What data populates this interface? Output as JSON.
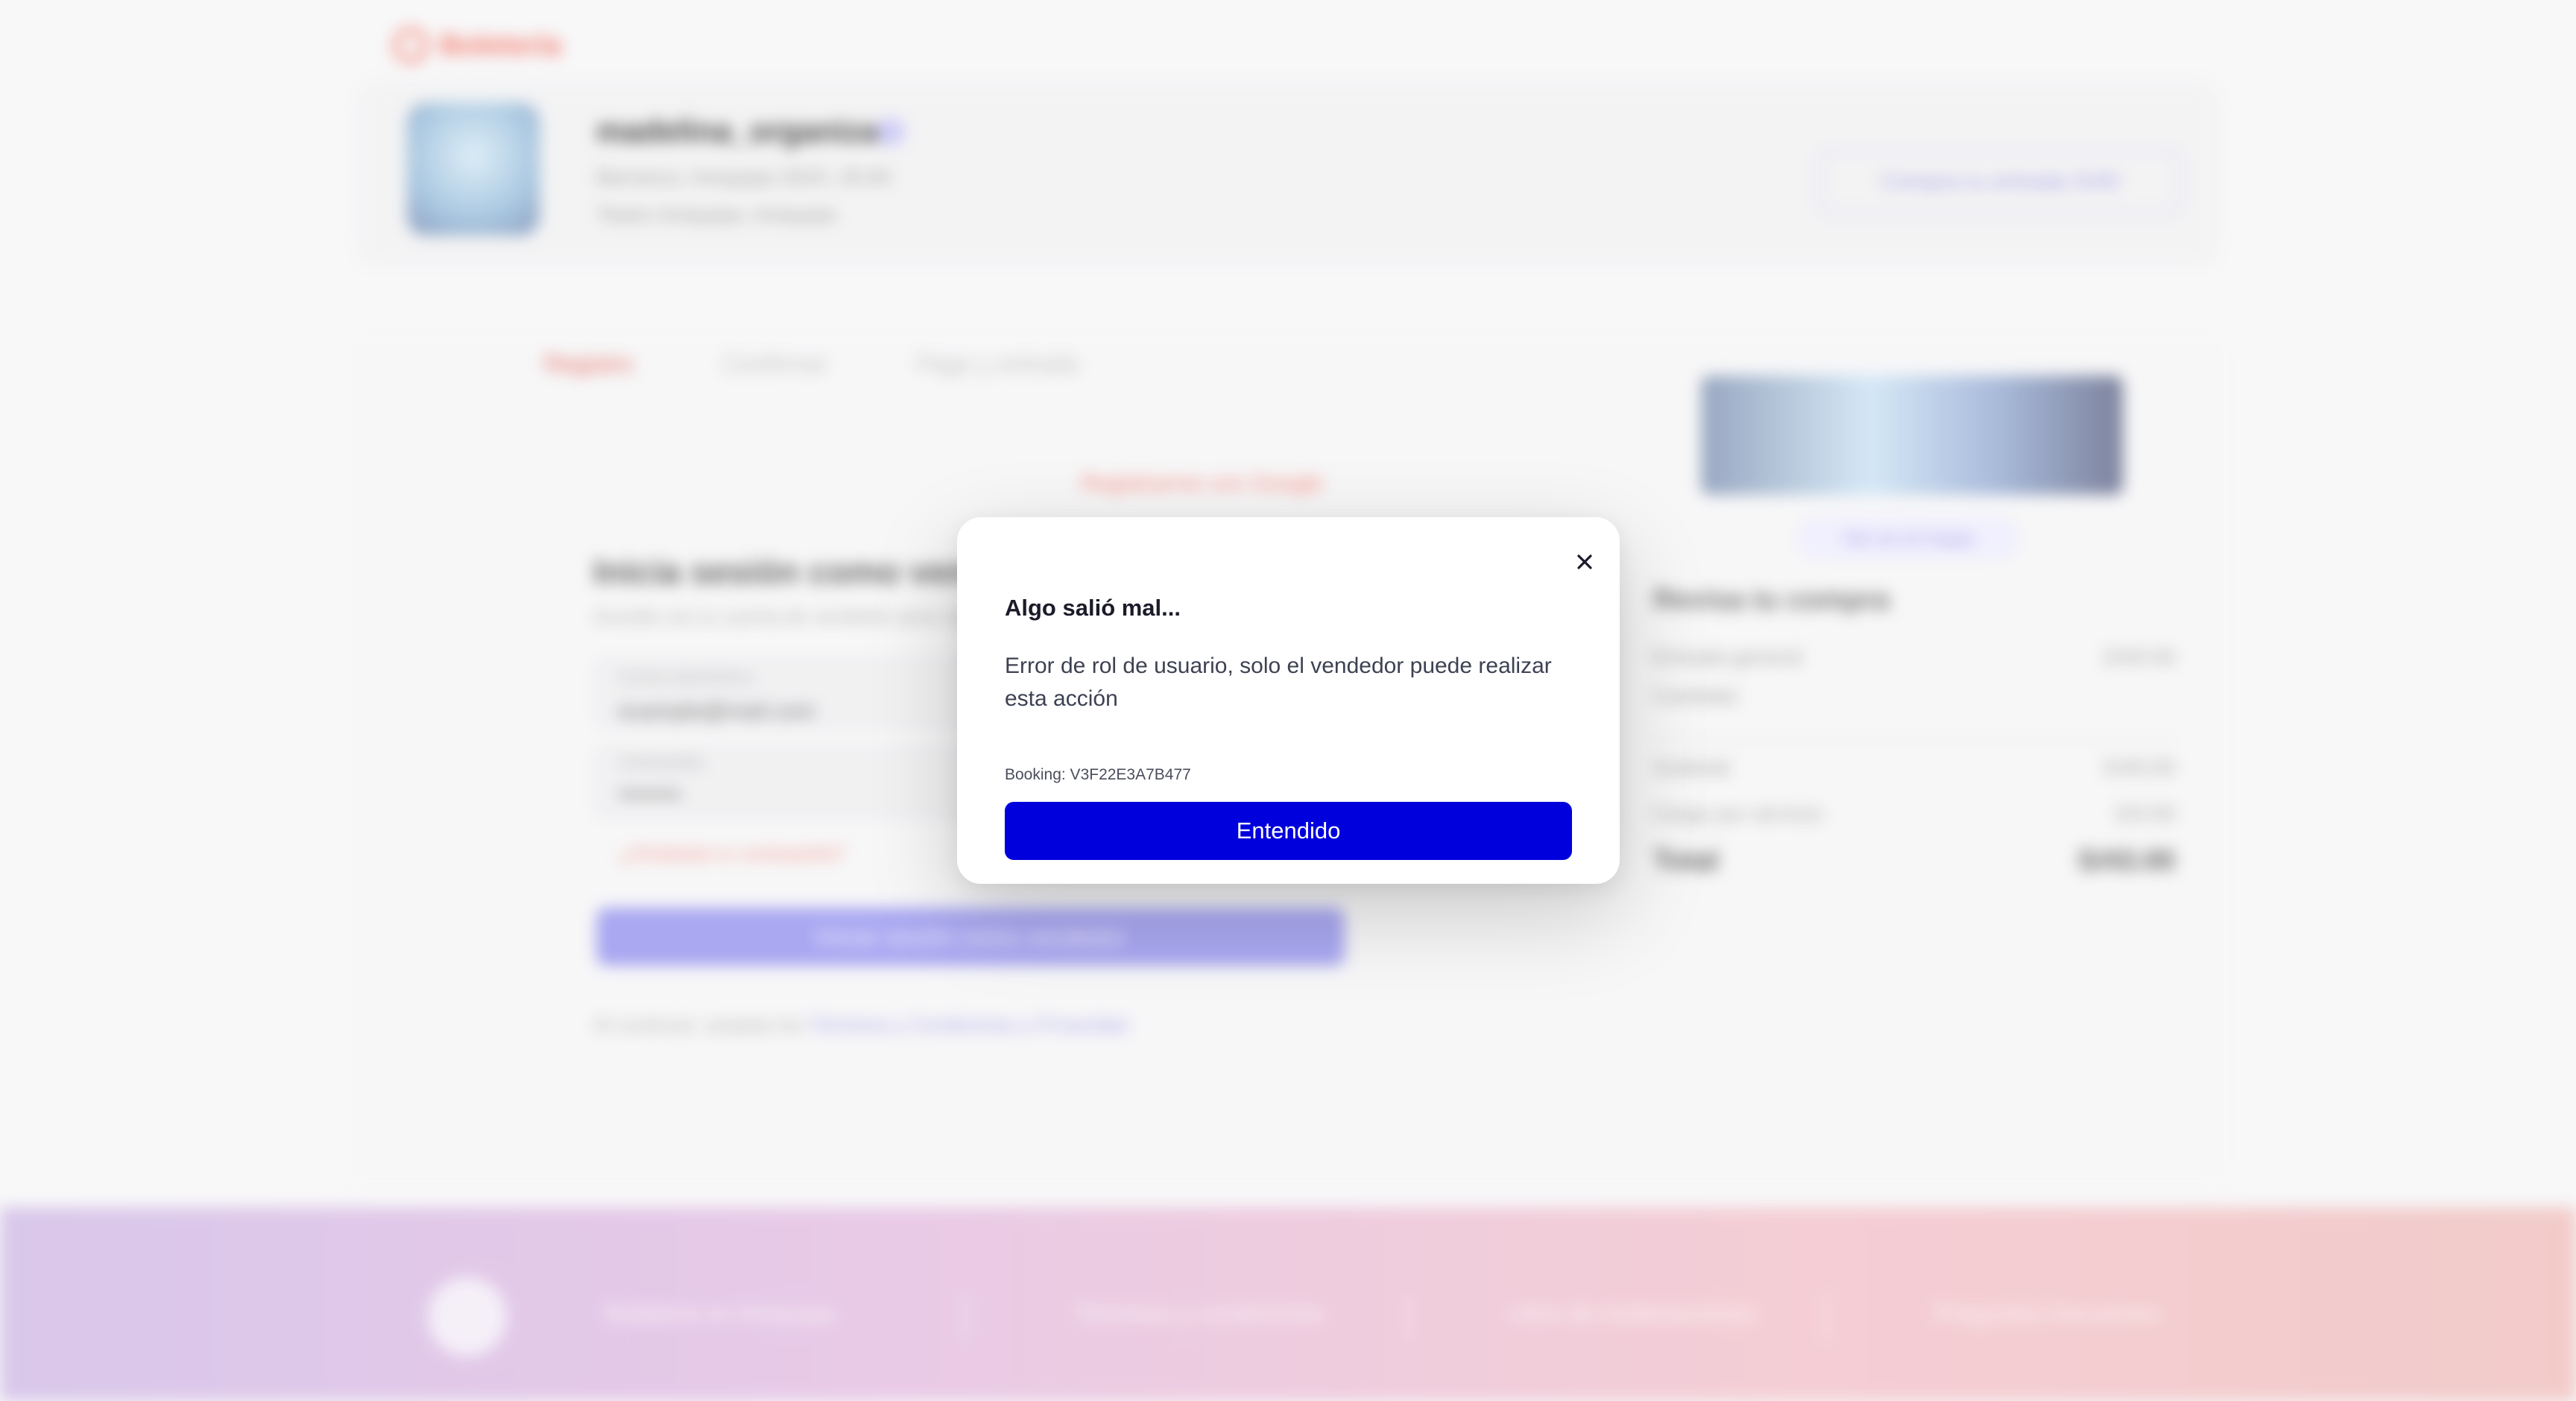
{
  "background": {
    "brand": "Boletería",
    "profile": {
      "username": "madelina_organiza",
      "line1": "Barranco, Arequipa 2024, 20:00",
      "line2": "Teatro Arequipa, Arequipa"
    },
    "header_button": "Compra tu entrada S/40",
    "steps": [
      "Registro",
      "Confirmar",
      "Pago y entrada"
    ],
    "red_link": "Registrarme con Google",
    "login": {
      "title": "Inicia sesión como vendedor",
      "subtitle": "Accede con tu cuenta de vendedor para continuar",
      "email_label": "Correo electrónico",
      "email_value": "example@mail.com",
      "password_label": "Contraseña",
      "password_value": "••••••••",
      "error_link": "¿Olvidaste tu contraseña?",
      "button": "Iniciar sesión como vendedor",
      "terms_prefix": "Al continuar, aceptas los ",
      "terms_link": "Términos y Condiciones y Privacidad"
    },
    "summary": {
      "pill": "Ver en el mapa",
      "title": "Revisa tu compra",
      "rows": [
        {
          "label": "Entrada general",
          "value": "S/40.00"
        },
        {
          "label": "Cantidad",
          "value": ""
        },
        {
          "label": "Subtotal",
          "value": "S/40.00"
        },
        {
          "label": "Cargo por servicio",
          "value": "S/3.00"
        }
      ],
      "total_label": "Total",
      "total_value": "S/43.00"
    },
    "footer": [
      "Boletería en Arequipa",
      "Términos y condiciones",
      "Libro de reclamaciones",
      "Preguntas frecuentes"
    ]
  },
  "modal": {
    "title": "Algo salió mal...",
    "message": "Error de rol de usuario, solo el vendedor puede realizar esta acción",
    "booking": "Booking: V3F22E3A7B477",
    "button": "Entendido"
  },
  "colors": {
    "primary_button": "#0000dc",
    "footer_gradient_start": "#d4c0e8",
    "footer_gradient_end": "#f1c4c2",
    "brand_accent": "#f26b5b"
  }
}
